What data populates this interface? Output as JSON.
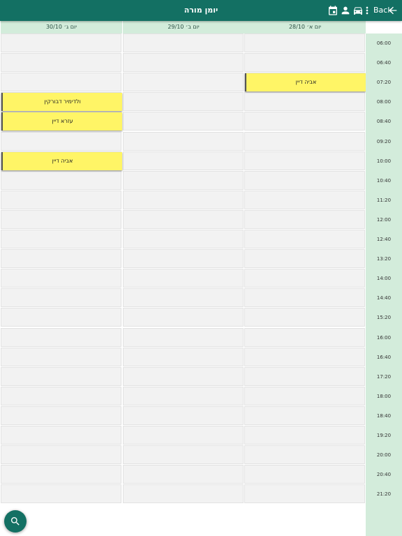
{
  "header": {
    "title": "יומן מורה",
    "back_label": "Back",
    "icons": [
      "back-arrow-icon",
      "more-vert-icon",
      "car-icon",
      "person-icon",
      "calendar-icon"
    ]
  },
  "days": [
    {
      "label": "יום ג׳ 30/10"
    },
    {
      "label": "יום ב׳ 29/10"
    },
    {
      "label": "יום א׳ 28/10"
    }
  ],
  "times": [
    "06:00",
    "06:40",
    "07:20",
    "08:00",
    "08:40",
    "09:20",
    "10:00",
    "10:40",
    "11:20",
    "12:00",
    "12:40",
    "13:20",
    "14:00",
    "14:40",
    "15:20",
    "16:00",
    "16:40",
    "17:20",
    "18:00",
    "18:40",
    "19:20",
    "20:00",
    "20:40",
    "21:20"
  ],
  "events": [
    {
      "day": 2,
      "slot": 2,
      "name": "אביה דיין"
    },
    {
      "day": 0,
      "slot": 3,
      "name": "ולדימיר דבורקין"
    },
    {
      "day": 0,
      "slot": 4,
      "name": "עזרא דיין"
    },
    {
      "day": 0,
      "slot": 6,
      "name": "אביה דיין"
    }
  ],
  "colors": {
    "topbar": "#137063",
    "time_column": "#d3ecdb",
    "event": "#fff566"
  },
  "fab": {
    "icon": "search-icon"
  }
}
